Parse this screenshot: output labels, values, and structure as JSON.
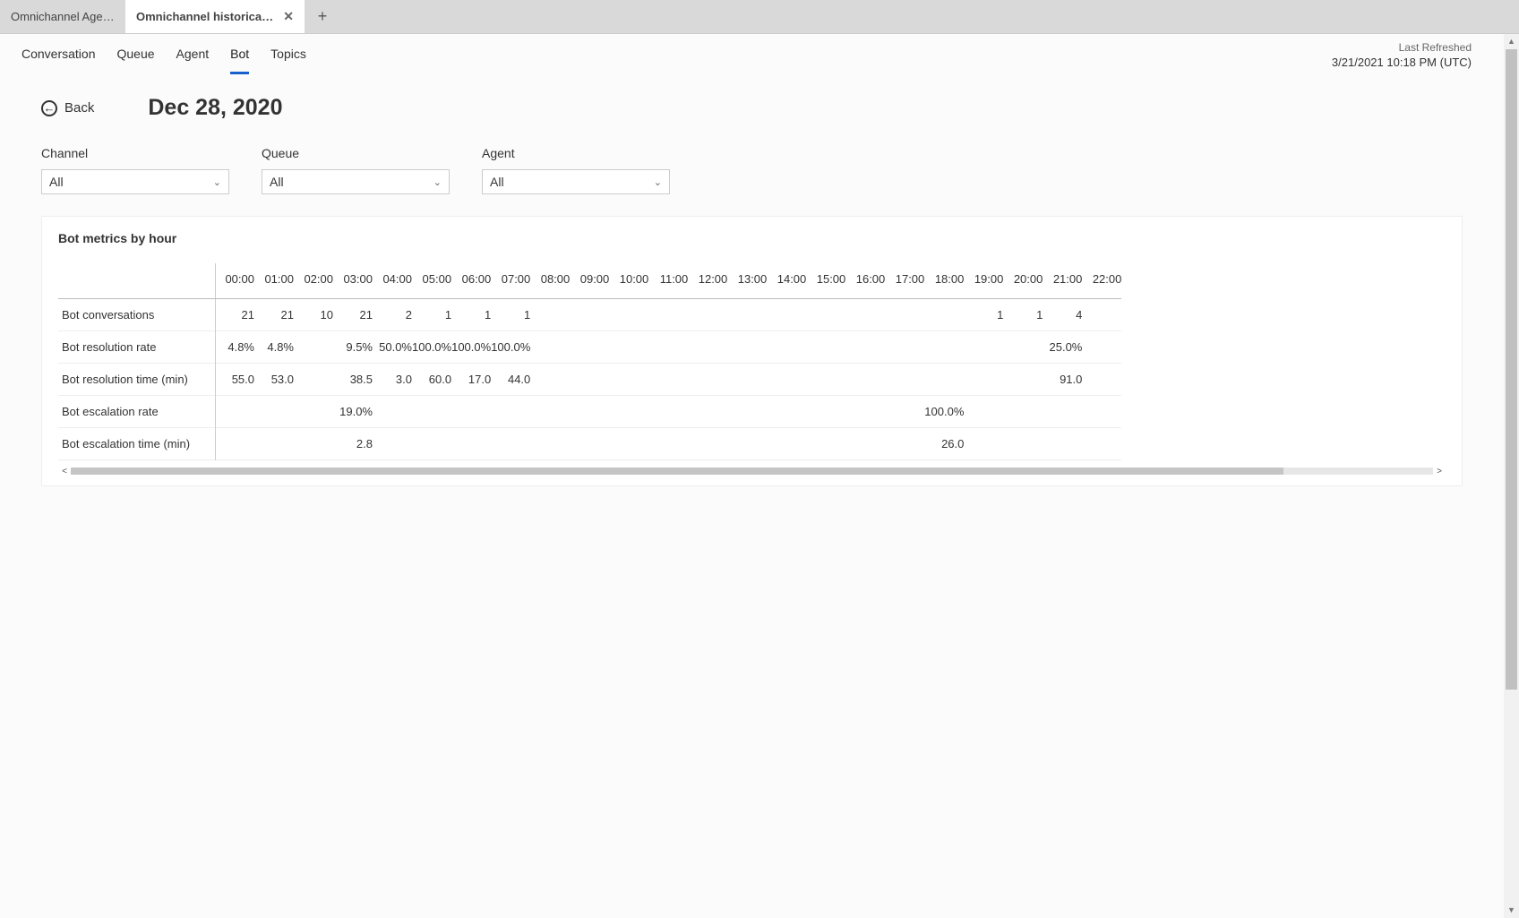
{
  "tabBar": {
    "tabs": [
      {
        "label": "Omnichannel Age…",
        "active": false,
        "close": false
      },
      {
        "label": "Omnichannel historical an…",
        "active": true,
        "close": true
      }
    ]
  },
  "pivots": [
    "Conversation",
    "Queue",
    "Agent",
    "Bot",
    "Topics"
  ],
  "activePivot": "Bot",
  "refresh": {
    "label": "Last Refreshed",
    "timestamp": "3/21/2021 10:18 PM (UTC)"
  },
  "backLabel": "Back",
  "pageDate": "Dec 28, 2020",
  "filters": [
    {
      "label": "Channel",
      "value": "All"
    },
    {
      "label": "Queue",
      "value": "All"
    },
    {
      "label": "Agent",
      "value": "All"
    }
  ],
  "card": {
    "title": "Bot metrics by hour",
    "hours": [
      "00:00",
      "01:00",
      "02:00",
      "03:00",
      "04:00",
      "05:00",
      "06:00",
      "07:00",
      "08:00",
      "09:00",
      "10:00",
      "11:00",
      "12:00",
      "13:00",
      "14:00",
      "15:00",
      "16:00",
      "17:00",
      "18:00",
      "19:00",
      "20:00",
      "21:00",
      "22:00"
    ],
    "metrics": [
      {
        "name": "Bot conversations",
        "values": [
          "21",
          "21",
          "10",
          "21",
          "2",
          "1",
          "1",
          "1",
          "",
          "",
          "",
          "",
          "",
          "",
          "",
          "",
          "",
          "",
          "",
          "1",
          "1",
          "4",
          ""
        ]
      },
      {
        "name": "Bot resolution rate",
        "values": [
          "4.8%",
          "4.8%",
          "",
          "9.5%",
          "50.0%",
          "100.0%",
          "100.0%",
          "100.0%",
          "",
          "",
          "",
          "",
          "",
          "",
          "",
          "",
          "",
          "",
          "",
          "",
          "",
          "25.0%",
          ""
        ]
      },
      {
        "name": "Bot resolution time (min)",
        "values": [
          "55.0",
          "53.0",
          "",
          "38.5",
          "3.0",
          "60.0",
          "17.0",
          "44.0",
          "",
          "",
          "",
          "",
          "",
          "",
          "",
          "",
          "",
          "",
          "",
          "",
          "",
          "91.0",
          ""
        ]
      },
      {
        "name": "Bot escalation rate",
        "values": [
          "",
          "",
          "",
          "19.0%",
          "",
          "",
          "",
          "",
          "",
          "",
          "",
          "",
          "",
          "",
          "",
          "",
          "",
          "",
          "100.0%",
          "",
          "",
          "",
          ""
        ]
      },
      {
        "name": "Bot escalation time (min)",
        "values": [
          "",
          "",
          "",
          "2.8",
          "",
          "",
          "",
          "",
          "",
          "",
          "",
          "",
          "",
          "",
          "",
          "",
          "",
          "",
          "26.0",
          "",
          "",
          "",
          ""
        ]
      }
    ]
  },
  "chart_data": {
    "type": "table",
    "title": "Bot metrics by hour — Dec 28, 2020",
    "hours": [
      "00:00",
      "01:00",
      "02:00",
      "03:00",
      "04:00",
      "05:00",
      "06:00",
      "07:00",
      "08:00",
      "09:00",
      "10:00",
      "11:00",
      "12:00",
      "13:00",
      "14:00",
      "15:00",
      "16:00",
      "17:00",
      "18:00",
      "19:00",
      "20:00",
      "21:00",
      "22:00"
    ],
    "series": [
      {
        "name": "Bot conversations",
        "unit": "count",
        "values": [
          21,
          21,
          10,
          21,
          2,
          1,
          1,
          1,
          null,
          null,
          null,
          null,
          null,
          null,
          null,
          null,
          null,
          null,
          null,
          1,
          1,
          4,
          null
        ]
      },
      {
        "name": "Bot resolution rate",
        "unit": "%",
        "values": [
          4.8,
          4.8,
          null,
          9.5,
          50.0,
          100.0,
          100.0,
          100.0,
          null,
          null,
          null,
          null,
          null,
          null,
          null,
          null,
          null,
          null,
          null,
          null,
          null,
          25.0,
          null
        ]
      },
      {
        "name": "Bot resolution time (min)",
        "unit": "min",
        "values": [
          55.0,
          53.0,
          null,
          38.5,
          3.0,
          60.0,
          17.0,
          44.0,
          null,
          null,
          null,
          null,
          null,
          null,
          null,
          null,
          null,
          null,
          null,
          null,
          null,
          91.0,
          null
        ]
      },
      {
        "name": "Bot escalation rate",
        "unit": "%",
        "values": [
          null,
          null,
          null,
          19.0,
          null,
          null,
          null,
          null,
          null,
          null,
          null,
          null,
          null,
          null,
          null,
          null,
          null,
          null,
          100.0,
          null,
          null,
          null,
          null
        ]
      },
      {
        "name": "Bot escalation time (min)",
        "unit": "min",
        "values": [
          null,
          null,
          null,
          2.8,
          null,
          null,
          null,
          null,
          null,
          null,
          null,
          null,
          null,
          null,
          null,
          null,
          null,
          null,
          26.0,
          null,
          null,
          null,
          null
        ]
      }
    ]
  }
}
